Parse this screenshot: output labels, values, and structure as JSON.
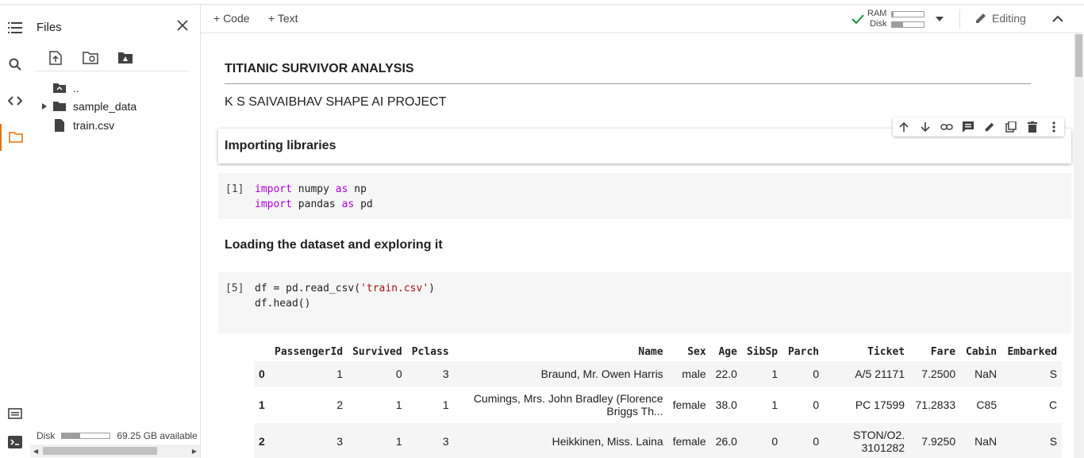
{
  "sidebar": {
    "title": "Files",
    "tree": [
      {
        "label": ".."
      },
      {
        "label": "sample_data"
      },
      {
        "label": "train.csv"
      }
    ],
    "disk_label": "Disk",
    "disk_available": "69.25 GB available",
    "disk_usage_fraction": 0.38
  },
  "toolbar": {
    "code_label": "+ Code",
    "text_label": "+ Text",
    "ram_label": "RAM",
    "disk_label": "Disk",
    "ram_usage_fraction": 0.05,
    "disk_usage_fraction": 0.35,
    "editing_label": "Editing"
  },
  "notebook": {
    "title": "TITIANIC SURVIVOR ANALYSIS",
    "subtitle": "K S SAIVAIBHAV SHAPE AI PROJECT",
    "section1": "Importing libraries",
    "cell1": {
      "prompt": "[1]",
      "line1": {
        "kw1": "import",
        "mod": " numpy ",
        "kw2": "as",
        "alias": " np"
      },
      "line2": {
        "kw1": "import",
        "mod": " pandas ",
        "kw2": "as",
        "alias": " pd"
      }
    },
    "section2": "Loading the dataset and exploring it",
    "cell2": {
      "prompt": "[5]",
      "line1_pre": "df = pd.read_csv(",
      "line1_str": "'train.csv'",
      "line1_post": ")",
      "line2": "df.head()"
    },
    "dataframe": {
      "columns": [
        "",
        "PassengerId",
        "Survived",
        "Pclass",
        "Name",
        "Sex",
        "Age",
        "SibSp",
        "Parch",
        "Ticket",
        "Fare",
        "Cabin",
        "Embarked"
      ],
      "rows": [
        [
          "0",
          "1",
          "0",
          "3",
          "Braund, Mr. Owen Harris",
          "male",
          "22.0",
          "1",
          "0",
          "A/5 21171",
          "7.2500",
          "NaN",
          "S"
        ],
        [
          "1",
          "2",
          "1",
          "1",
          "Cumings, Mrs. John Bradley (Florence Briggs Th...",
          "female",
          "38.0",
          "1",
          "0",
          "PC 17599",
          "71.2833",
          "C85",
          "C"
        ],
        [
          "2",
          "3",
          "1",
          "3",
          "Heikkinen, Miss. Laina",
          "female",
          "26.0",
          "0",
          "0",
          "STON/O2. 3101282",
          "7.9250",
          "NaN",
          "S"
        ]
      ]
    }
  }
}
